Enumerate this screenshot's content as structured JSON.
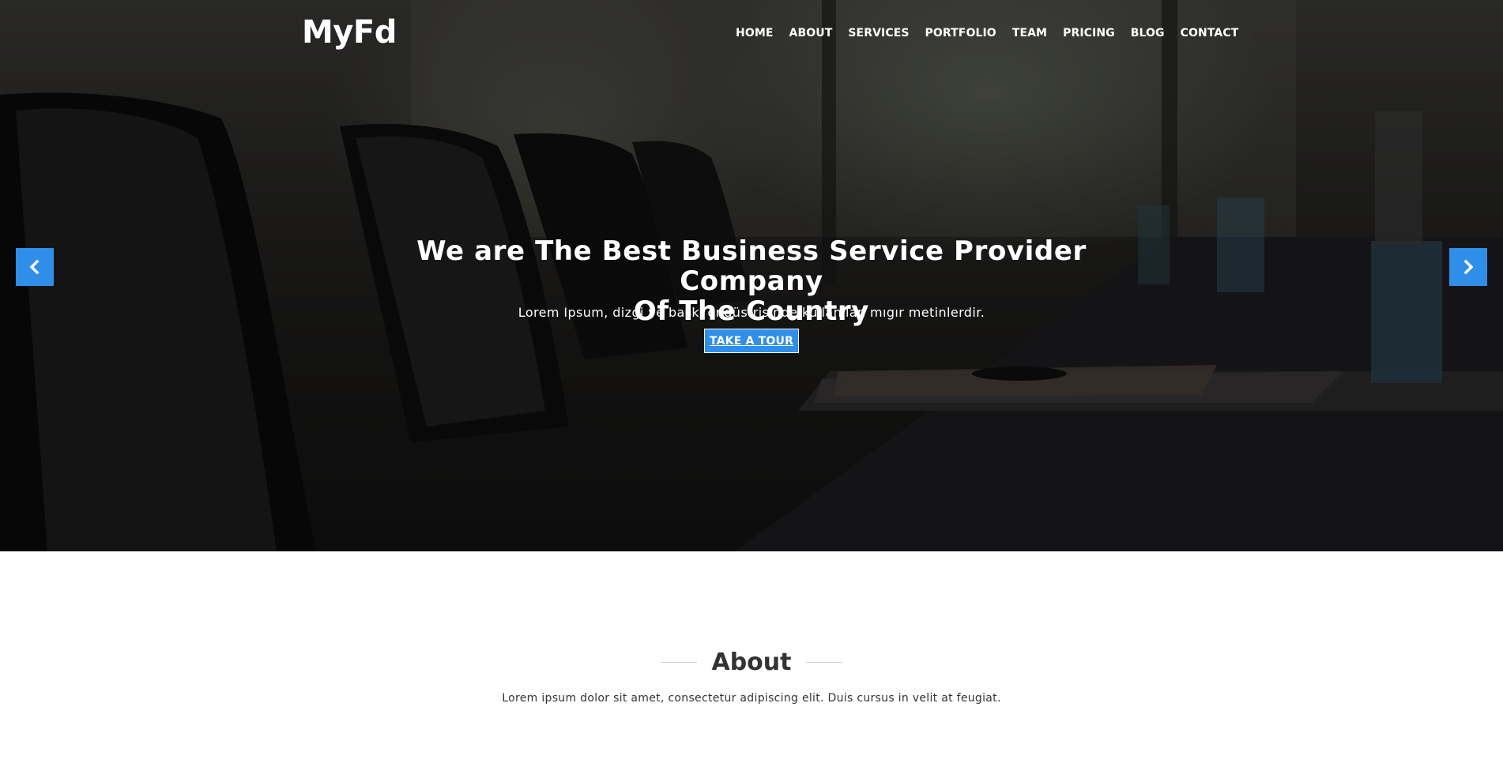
{
  "brand": {
    "logo": "MyFd"
  },
  "nav": {
    "items": [
      {
        "label": "HOME"
      },
      {
        "label": "ABOUT"
      },
      {
        "label": "SERVICES"
      },
      {
        "label": "PORTFOLIO"
      },
      {
        "label": "TEAM"
      },
      {
        "label": "PRICING"
      },
      {
        "label": "BLOG"
      },
      {
        "label": "CONTACT"
      }
    ]
  },
  "hero": {
    "title_line1": "We are The Best Business Service Provider Company",
    "title_line2": "Of The Country",
    "subtitle": "Lorem Ipsum, dizgi ve baskı endüstrisinde kullanılan mıgır metinlerdir.",
    "cta_label": "TAKE A TOUR",
    "prev_icon": "chevron-left-icon",
    "next_icon": "chevron-right-icon"
  },
  "about": {
    "title": "About",
    "text": "Lorem ipsum dolor sit amet, consectetur adipiscing elit. Duis cursus in velit at feugiat."
  },
  "colors": {
    "accent": "#2f8ee8",
    "text_dark": "#333333",
    "white": "#ffffff"
  }
}
